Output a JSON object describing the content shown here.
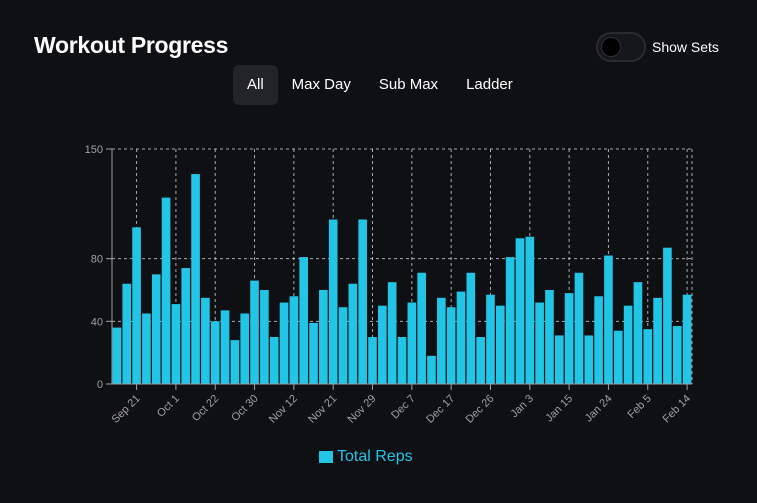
{
  "header": {
    "title": "Workout Progress",
    "toggle": {
      "label": "Show Sets",
      "on": false
    }
  },
  "tabs": [
    {
      "label": "All",
      "active": true
    },
    {
      "label": "Max Day",
      "active": false
    },
    {
      "label": "Sub Max",
      "active": false
    },
    {
      "label": "Ladder",
      "active": false
    }
  ],
  "colors": {
    "background": "#0f1014",
    "bar": "#22c5e6",
    "grid": "#d0d0d0",
    "axis_text": "#a0a0a0"
  },
  "chart_data": {
    "type": "bar",
    "ylim": [
      0,
      150
    ],
    "y_ticks": [
      0,
      40,
      80,
      150
    ],
    "x_tick_labels": [
      "Sep 21",
      "Oct 1",
      "Oct 22",
      "Oct 30",
      "Nov 12",
      "Nov 21",
      "Nov 29",
      "Dec 7",
      "Dec 17",
      "Dec 26",
      "Jan 3",
      "Jan 15",
      "Jan 24",
      "Feb 5",
      "Feb 14"
    ],
    "x_tick_bar_index": [
      2,
      6,
      10,
      14,
      18,
      22,
      26,
      30,
      34,
      38,
      42,
      46,
      50,
      54,
      58
    ],
    "grid": true,
    "legend_position": "bottom",
    "series": [
      {
        "name": "Total Reps",
        "values": [
          36,
          64,
          100,
          45,
          70,
          119,
          51,
          74,
          134,
          55,
          40,
          47,
          28,
          45,
          66,
          60,
          30,
          52,
          56,
          81,
          39,
          60,
          105,
          49,
          64,
          105,
          30,
          50,
          65,
          30,
          52,
          71,
          18,
          55,
          49,
          59,
          71,
          30,
          57,
          50,
          81,
          93,
          94,
          52,
          60,
          31,
          58,
          71,
          31,
          56,
          82,
          34,
          50,
          65,
          35,
          55,
          87,
          37,
          57
        ]
      }
    ]
  }
}
